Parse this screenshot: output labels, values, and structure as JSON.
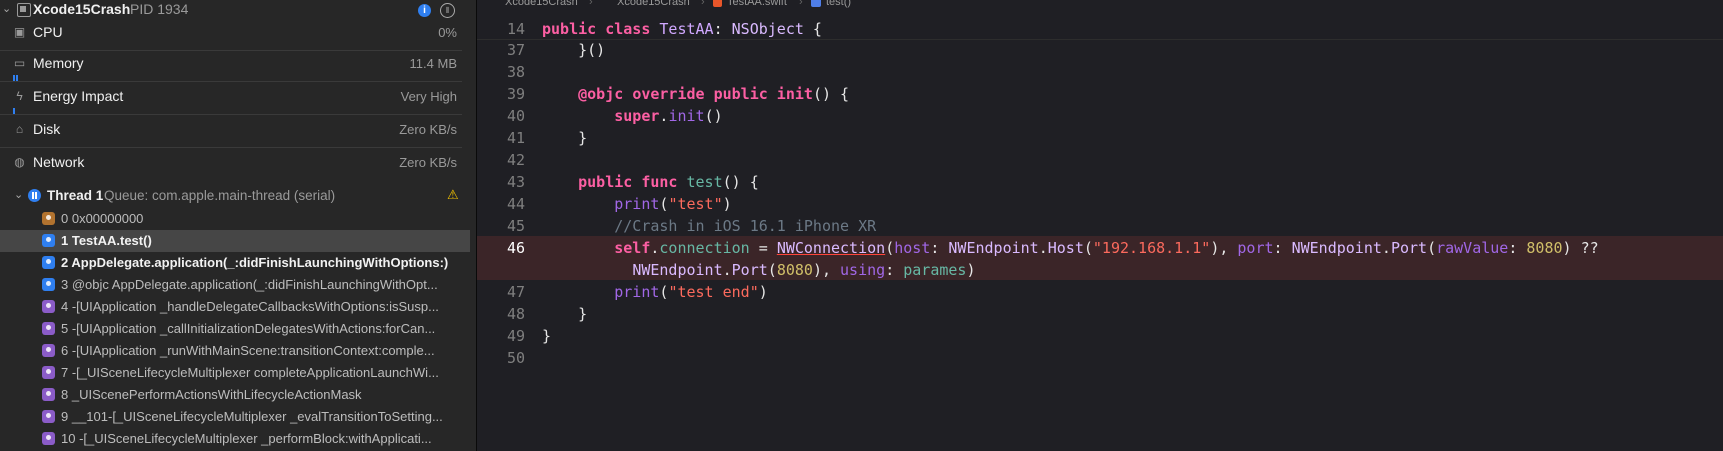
{
  "process": {
    "name": "Xcode15Crash",
    "pid": "PID 1934"
  },
  "gauges": [
    {
      "label": "CPU",
      "value": "0%"
    },
    {
      "label": "Memory",
      "value": "11.4 MB"
    },
    {
      "label": "Energy Impact",
      "value": "Very High"
    },
    {
      "label": "Disk",
      "value": "Zero KB/s"
    },
    {
      "label": "Network",
      "value": "Zero KB/s"
    }
  ],
  "thread": {
    "name": "Thread 1",
    "queue": "Queue: com.apple.main-thread (serial)"
  },
  "frames": [
    {
      "text": "0 0x00000000"
    },
    {
      "text": "1 TestAA.test()"
    },
    {
      "text": "2 AppDelegate.application(_:didFinishLaunchingWithOptions:)"
    },
    {
      "text": "3 @objc AppDelegate.application(_:didFinishLaunchingWithOpt..."
    },
    {
      "text": "4 -[UIApplication _handleDelegateCallbacksWithOptions:isSusp..."
    },
    {
      "text": "5 -[UIApplication _callInitializationDelegatesWithActions:forCan..."
    },
    {
      "text": "6 -[UIApplication _runWithMainScene:transitionContext:comple..."
    },
    {
      "text": "7 -[_UISceneLifecycleMultiplexer completeApplicationLaunchWi..."
    },
    {
      "text": "8 _UIScenePerformActionsWithLifecycleActionMask"
    },
    {
      "text": "9 __101-[_UISceneLifecycleMultiplexer _evalTransitionToSetting..."
    },
    {
      "text": "10 -[_UISceneLifecycleMultiplexer _performBlock:withApplicati..."
    }
  ],
  "jumpbar": {
    "project": "Xcode15Crash",
    "group": "Xcode15Crash",
    "file": "TestAA.swift",
    "method": "test()"
  },
  "code": {
    "ln_14": "14",
    "ln_37": "37",
    "ln_38": "38",
    "ln_39": "39",
    "ln_40": "40",
    "ln_41": "41",
    "ln_42": "42",
    "ln_43": "43",
    "ln_44": "44",
    "ln_45": "45",
    "ln_46": "46",
    "ln_47": "47",
    "ln_48": "48",
    "ln_49": "49",
    "ln_50": "50",
    "class_name": "TestAA",
    "super_name": "NSObject",
    "comment": "//Crash in iOS 16.1 iPhone XR",
    "print1": "\"test\"",
    "print2": "\"test end\"",
    "host_str": "\"192.168.1.1\"",
    "port_num": "8080",
    "port_num2": "8080"
  }
}
